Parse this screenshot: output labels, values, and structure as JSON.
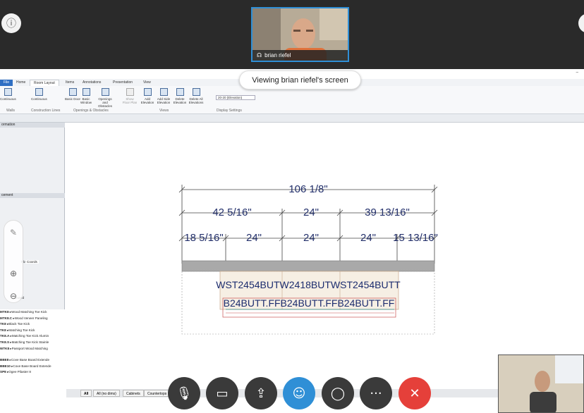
{
  "meeting": {
    "presenter_name": "brian riefel",
    "sharing_banner": "Viewing brian riefel's screen",
    "info_icon": "info-icon",
    "controls": [
      {
        "name": "mute-button",
        "icon": "microphone-off-icon",
        "color": "#3a3a3a"
      },
      {
        "name": "video-button",
        "icon": "camera-off-icon",
        "color": "#3a3a3a"
      },
      {
        "name": "share-button",
        "icon": "share-icon",
        "color": "#3a3a3a"
      },
      {
        "name": "participants-button",
        "icon": "person-icon",
        "color": "#2f8fd6"
      },
      {
        "name": "chat-button",
        "icon": "chat-icon",
        "color": "#3a3a3a"
      },
      {
        "name": "more-button",
        "icon": "more-icon",
        "color": "#3a3a3a"
      },
      {
        "name": "end-call-button",
        "icon": "close-icon",
        "color": "#e5403a"
      }
    ]
  },
  "app": {
    "ribbon_tabs": [
      "File",
      "Home",
      "Room Layout",
      "Items",
      "Annotations",
      "Presentation",
      "View"
    ],
    "active_tab": "Room Layout",
    "ribbon_groups": [
      {
        "label": "Walls"
      },
      {
        "label": "Construction Lines"
      },
      {
        "label": "Openings & Obstacles"
      },
      {
        "label": "Views"
      },
      {
        "label": "Display Settings"
      }
    ],
    "ribbon_buttons": [
      "Continuous",
      "Continuous",
      "Basic Door",
      "Basic Window",
      "Openings and Obstacles",
      "Show Floor Plan",
      "Add Elevation",
      "Add Side Elevation",
      "Delete Elevation",
      "Delete All Elevations"
    ],
    "display_setting_value": "20-20 (Elevation)",
    "left_panel": {
      "header_info": "ormation",
      "header_placement": "cement",
      "placement_tabs": [
        "Plan",
        "Elev",
        "Coords"
      ],
      "bowed_label": "Bowed",
      "items": [
        {
          "code": "MTK8",
          "desc": "Wood Matching Toe Kick"
        },
        {
          "code": "MTK8.C",
          "desc": "Wood Veneer Paneling"
        },
        {
          "code": "TK8",
          "desc": "Black Toe Kick"
        },
        {
          "code": "TK8",
          "desc": "Matching Toe Kick"
        },
        {
          "code": "TK8.A",
          "desc": "Matching Toe Kick Alumin"
        },
        {
          "code": "TK8.S",
          "desc": "Matching Toe Kick Stainle"
        },
        {
          "code": "WTK8",
          "desc": "Passport Wood Matching"
        },
        {
          "code": "BBE8",
          "desc": "Cove Base Board Extende"
        },
        {
          "code": "BBE10",
          "desc": "Cove Base Board Extende"
        },
        {
          "code": "SP8",
          "desc": "Ogee Pilaster 8"
        }
      ]
    },
    "bottom_tabs": [
      "All",
      "All (no dims)",
      "Cabinets",
      "Countertops"
    ]
  },
  "elevation": {
    "overall": "106 1/8\"",
    "tier2": [
      "42 5/16\"",
      "24\"",
      "39 13/16\""
    ],
    "tier3": [
      "18 5/16\"",
      "24\"",
      "24\"",
      "24\"",
      "15 13/16\""
    ],
    "wall_label": "WST2454BUTW2418BUTWST2454BUTT",
    "base_label": "B24BUTT.FFB24BUTT.FFB24BUTT.FF",
    "dimension_color": "#23306b",
    "cabinet_text_color": "#1c2c6e"
  }
}
